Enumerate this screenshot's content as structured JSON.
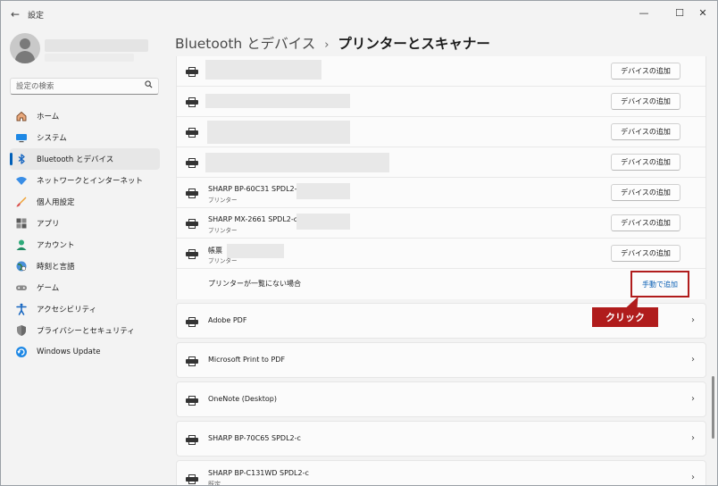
{
  "window": {
    "app_title": "設定",
    "back_glyph": "←",
    "minimize_glyph": "—",
    "maximize_glyph": "☐",
    "close_glyph": "✕"
  },
  "search": {
    "placeholder": "設定の検索",
    "icon": "search-icon"
  },
  "sidebar": {
    "items": [
      {
        "label": "ホーム",
        "icon": "home-icon"
      },
      {
        "label": "システム",
        "icon": "monitor-icon"
      },
      {
        "label": "Bluetooth とデバイス",
        "icon": "bluetooth-icon",
        "active": true
      },
      {
        "label": "ネットワークとインターネット",
        "icon": "wifi-icon"
      },
      {
        "label": "個人用設定",
        "icon": "brush-icon"
      },
      {
        "label": "アプリ",
        "icon": "apps-icon"
      },
      {
        "label": "アカウント",
        "icon": "account-icon"
      },
      {
        "label": "時刻と言語",
        "icon": "globe-icon"
      },
      {
        "label": "ゲーム",
        "icon": "gamepad-icon"
      },
      {
        "label": "アクセシビリティ",
        "icon": "accessibility-icon"
      },
      {
        "label": "プライバシーとセキュリティ",
        "icon": "shield-icon"
      },
      {
        "label": "Windows Update",
        "icon": "update-icon"
      }
    ]
  },
  "header": {
    "parent": "Bluetooth とデバイス",
    "separator": "›",
    "current": "プリンターとスキャナー"
  },
  "network_printers": {
    "add_label": "デバイスの追加",
    "rows": [
      {
        "name": "",
        "sub": ""
      },
      {
        "name": "",
        "sub": ""
      },
      {
        "name": "",
        "sub": ""
      },
      {
        "name": "",
        "sub": ""
      },
      {
        "name": "SHARP BP-60C31 SPDL2-c",
        "sub": "プリンター"
      },
      {
        "name": "SHARP MX-2661 SPDL2-c",
        "sub": "プリンター"
      },
      {
        "name": "帳票",
        "sub": "プリンター"
      }
    ],
    "not_listed_label": "プリンターが一覧にない場合",
    "manual_add_label": "手動で追加"
  },
  "callout": {
    "label": "クリック",
    "color": "#b01c1c"
  },
  "installed_printers": [
    {
      "name": "Adobe PDF",
      "sub": ""
    },
    {
      "name": "Microsoft Print to PDF",
      "sub": ""
    },
    {
      "name": "OneNote (Desktop)",
      "sub": ""
    },
    {
      "name": "SHARP BP-70C65 SPDL2-c",
      "sub": ""
    },
    {
      "name": "SHARP BP-C131WD SPDL2-c",
      "sub": "既定"
    }
  ],
  "chevron_glyph": "›",
  "colors": {
    "accent": "#005fb8",
    "link": "#0a5fb4",
    "highlight_box": "#b01c1c"
  }
}
